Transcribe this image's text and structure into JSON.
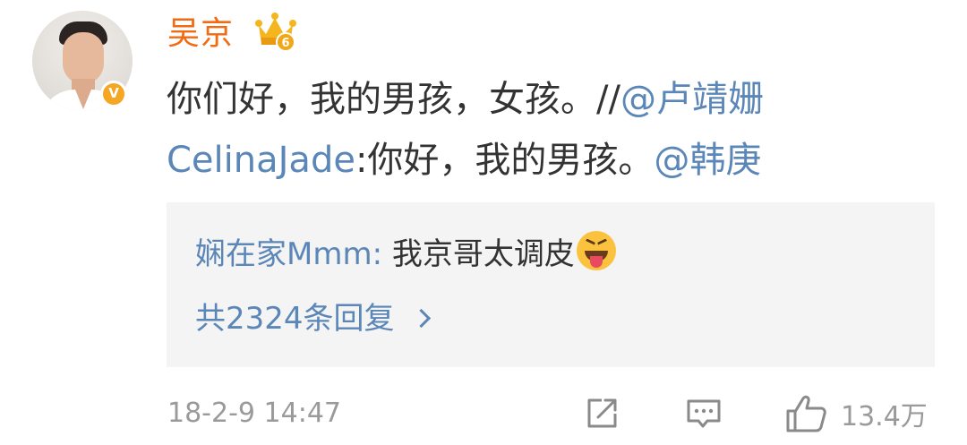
{
  "post": {
    "user": {
      "name": "吴京",
      "verified_badge": "V",
      "crown_level": "6",
      "avatar_icon": "user-avatar",
      "name_color": "#f26a12"
    },
    "text": {
      "part1": "你们好，我的男孩，女孩。//",
      "mention1": "@卢靖姗CelinaJade",
      "part2": ":你好，我的男孩。",
      "mention2": "@韩庚"
    },
    "link_color": "#5b86b8"
  },
  "reply_preview": {
    "username": "娴在家Mmm:",
    "text": "我京哥太调皮",
    "emoji": "squinting-tongue-emoji",
    "count_label": "共2324条回复"
  },
  "footer": {
    "timestamp": "18-2-9 14:47",
    "share_icon": "share-icon",
    "comment_icon": "comment-icon",
    "like_icon": "thumbs-up-icon",
    "like_count": "13.4万"
  }
}
